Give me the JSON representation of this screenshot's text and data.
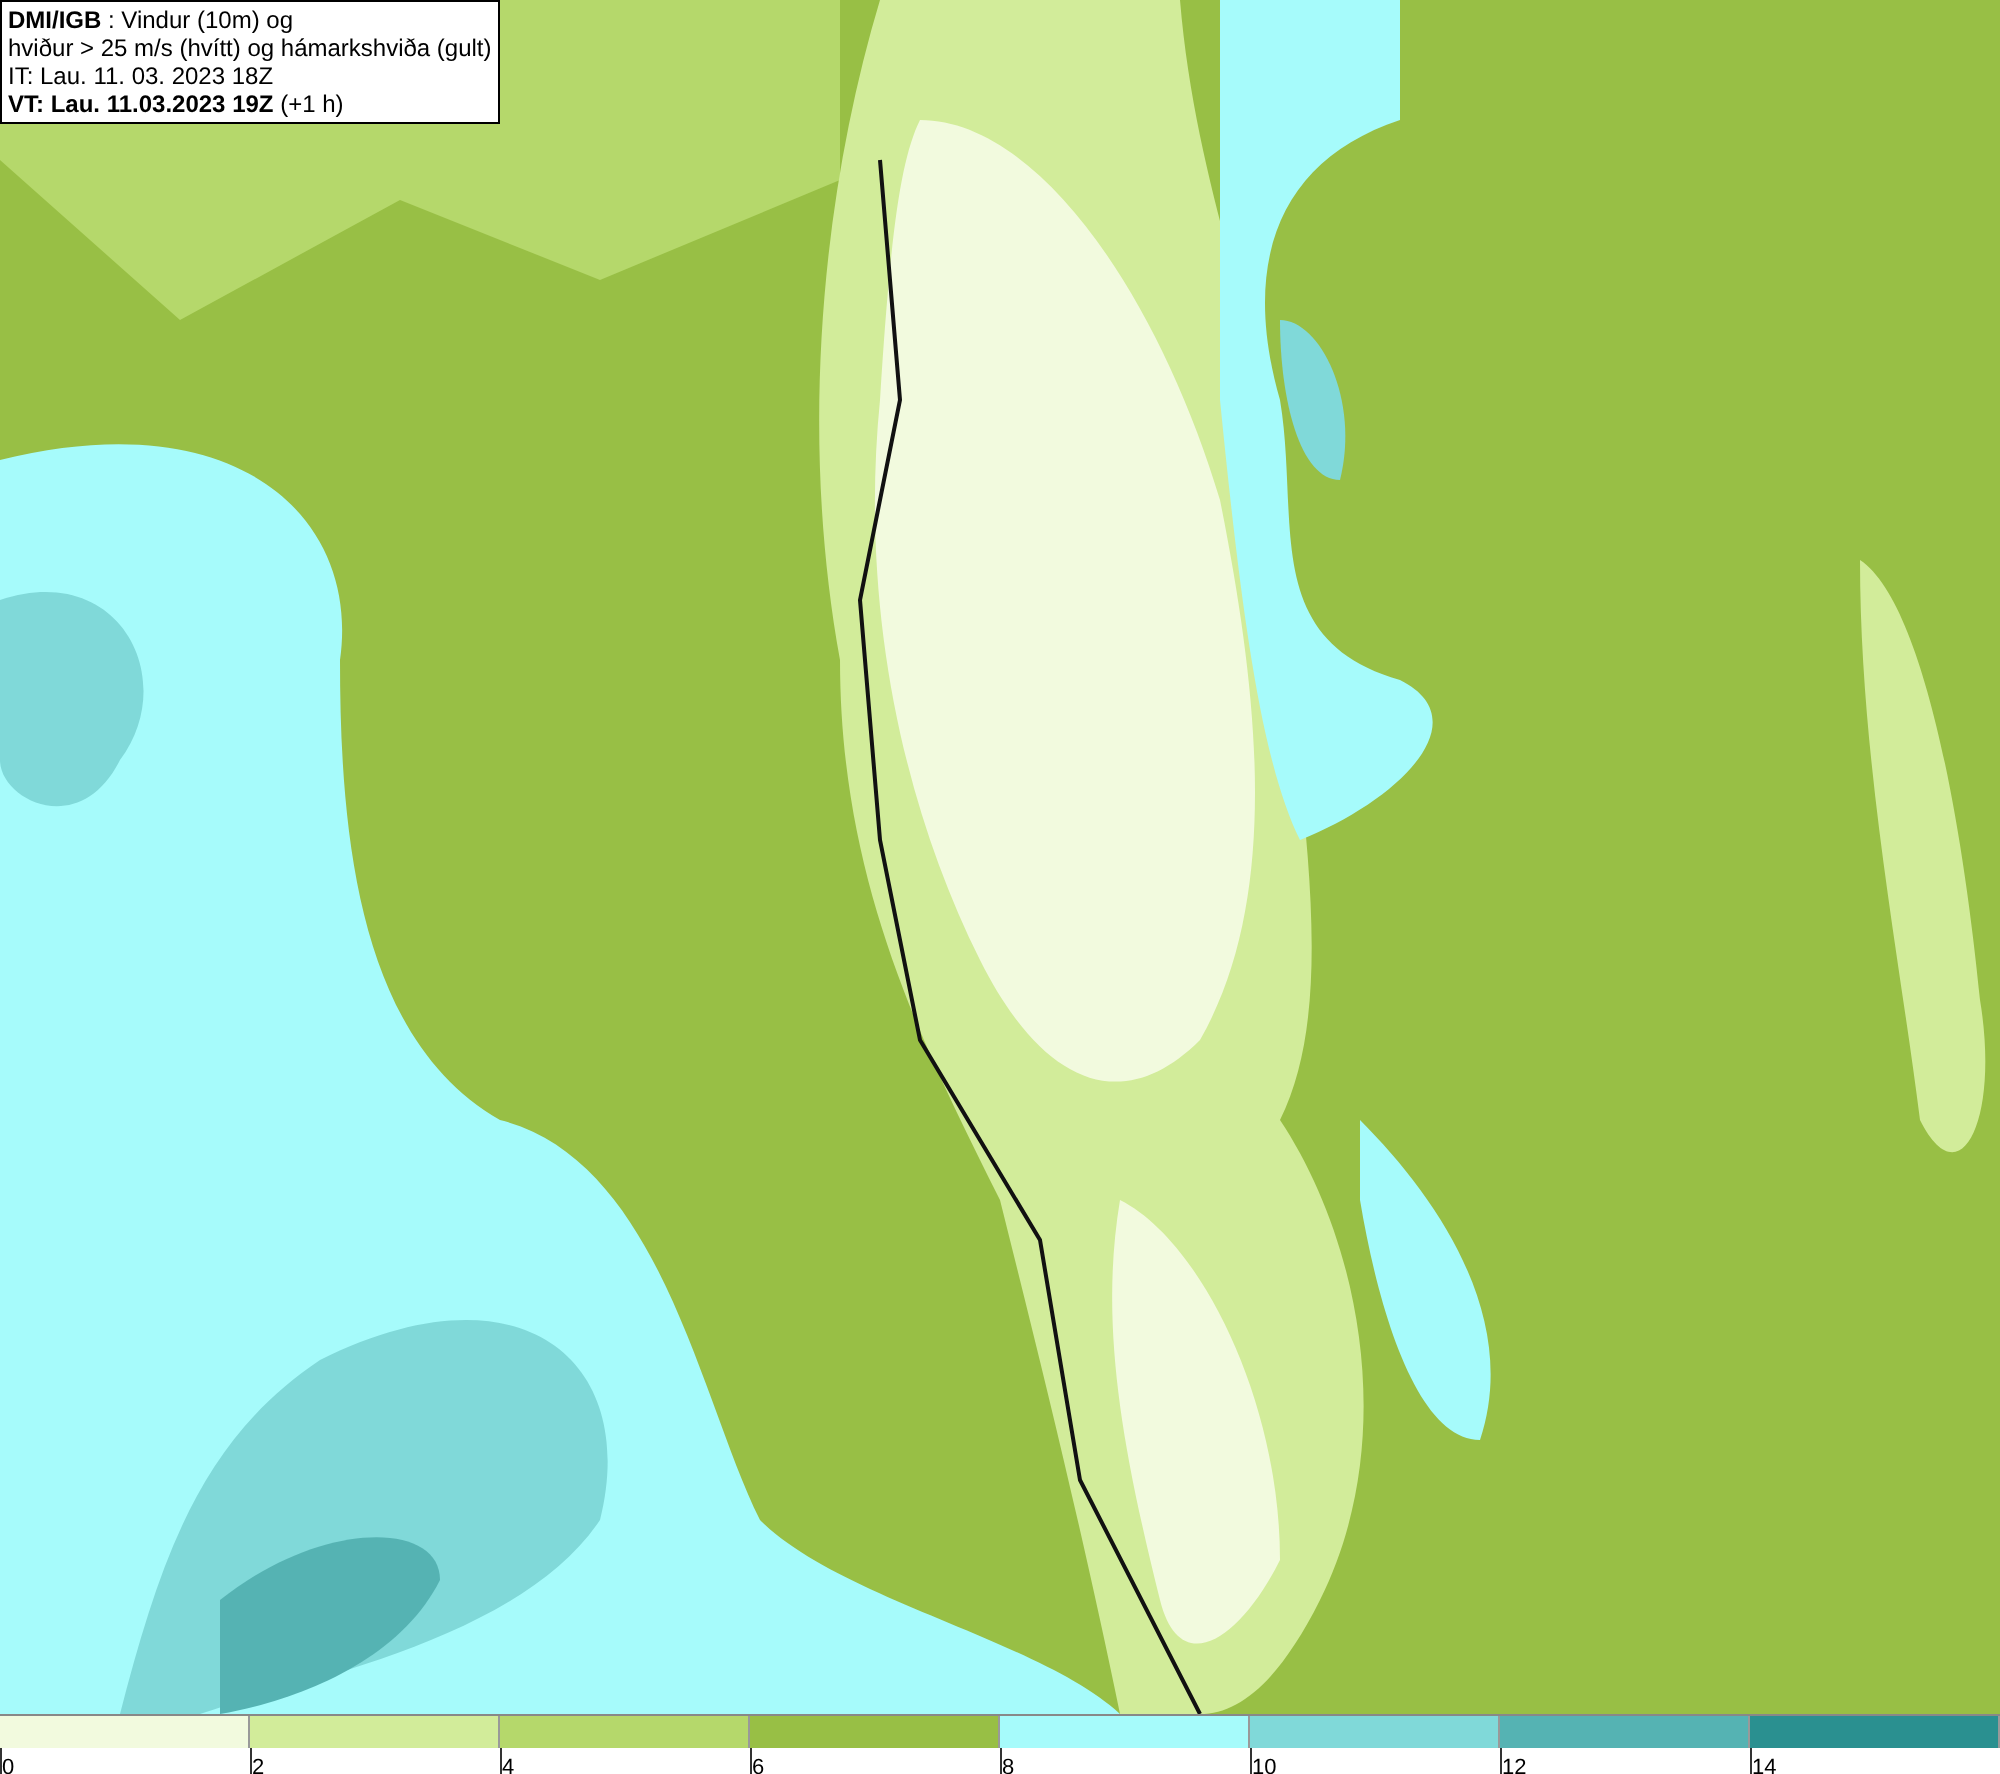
{
  "map": {
    "title_box": {
      "lines": [
        "**DMI/IGB** : Vindur (10m) og",
        "hviður > 25 m/s (hvítt) og hámarkshviða (gult)",
        "IT: Lau. 11. 03. 2023 18Z",
        "**VT: Lau. 11.03.2023 19Z** (+1 h)"
      ]
    }
  },
  "legend": {
    "bins": [
      {
        "color": "#f2fade"
      },
      {
        "color": "#d2ec9a"
      },
      {
        "color": "#b5d86b"
      },
      {
        "color": "#98bf45"
      },
      {
        "color": "#a6fbfb"
      },
      {
        "color": "#80d9d9"
      },
      {
        "color": "#55b3b3"
      },
      {
        "color": "#2a9090"
      }
    ],
    "ticks": [
      "0",
      "2",
      "4",
      "6",
      "8",
      "10",
      "12",
      "14"
    ]
  }
}
